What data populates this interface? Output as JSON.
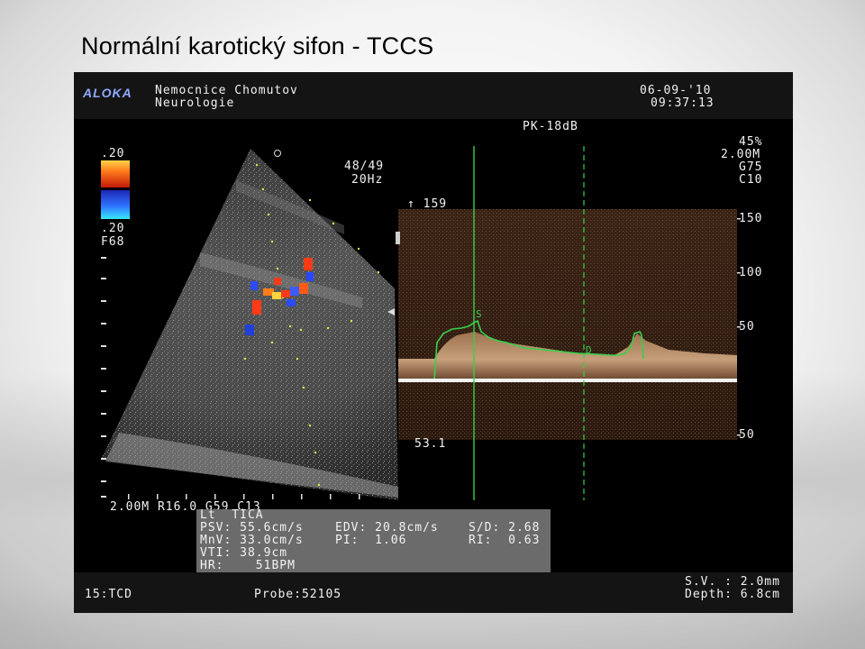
{
  "slide": {
    "title": "Normální karotický sifon - TCCS"
  },
  "header": {
    "brand": "ALOKA",
    "hospital": "Nemocnice Chomutov",
    "department": "Neurologie",
    "date": "06-09-'10",
    "time": "09:37:13",
    "pk_label": "PK-18dB"
  },
  "right_params": {
    "gain": "45%",
    "depth": "2.00M",
    "g": "G75",
    "c": "C10"
  },
  "color_scale": {
    "top": ".20",
    "bottom": ".20",
    "filter": "F68"
  },
  "color_doppler": {
    "prf": "48/49",
    "freq": "20Hz"
  },
  "spectral": {
    "max_marker": "↑ 159",
    "angle": "53.1",
    "scale_labels": [
      "150",
      "100",
      "50",
      "50"
    ],
    "marker_s": "S",
    "marker_d": "D"
  },
  "bmode_settings": "2.00M R16.0 G59 C13",
  "measurements": {
    "vessel": "Lt  TICA",
    "psv": "PSV: 55.6cm/s",
    "edv": "EDV: 20.8cm/s",
    "sd": "S/D: 2.68",
    "mnv": "MnV: 33.0cm/s",
    "pi": "PI:  1.06",
    "ri": "RI:  0.63",
    "vti": "VTI: 38.9cm",
    "hr": "HR:    51BPM"
  },
  "footer": {
    "mode": "15:TCD",
    "probe": "Probe:52105",
    "sv": "S.V. : 2.0mm",
    "depth": "Depth: 6.8cm"
  },
  "colors": {
    "header_bg": "#141414",
    "spectrum": "#c8a07a",
    "trace": "#37d04b",
    "logo": "#8fa9ff",
    "calc_bg": "#6b6b6b"
  }
}
